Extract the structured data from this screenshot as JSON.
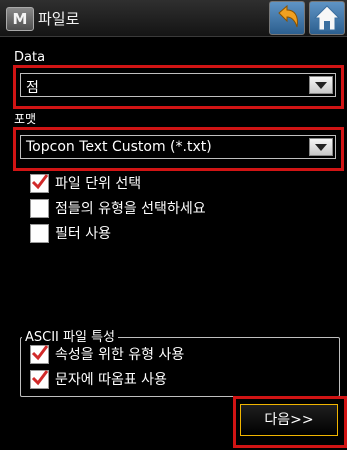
{
  "header": {
    "title": "파일로",
    "app_icon_letter": "M"
  },
  "data_field": {
    "label": "Data",
    "value": "점"
  },
  "format_field": {
    "label": "포맷",
    "value": "Topcon Text Custom (*.txt)"
  },
  "options": [
    {
      "label": "파일 단위 선택",
      "checked": true
    },
    {
      "label": "점들의 유형을 선택하세요",
      "checked": false
    },
    {
      "label": "필터 사용",
      "checked": false
    }
  ],
  "ascii_group": {
    "title": "ASCII 파일 특성",
    "options": [
      {
        "label": "속성을 위한 유형 사용",
        "checked": true
      },
      {
        "label": "문자에 따옴표 사용",
        "checked": true
      }
    ]
  },
  "footer": {
    "next_label": "다음>>"
  },
  "colors": {
    "highlight_frame": "#d11414",
    "check_mark": "#d12a2a",
    "next_border": "#f0b400"
  }
}
